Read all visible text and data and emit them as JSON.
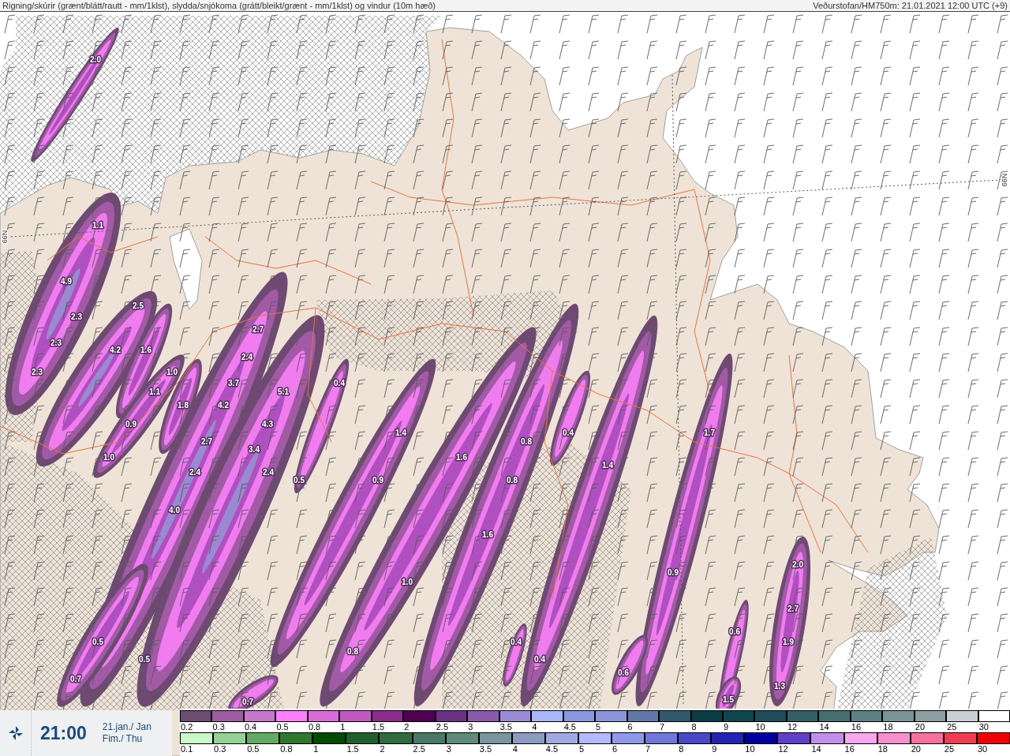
{
  "header": {
    "title": "Rigning/skúrir (grænt/blátt/rautt - mm/1klst), slydda/snjókoma (grátt/bleikt/grænt - mm/1klst) og vindur (10m hæð)",
    "source": "Veðurstofan/HM750m: 21.01.2021 12:00 UTC (+9)"
  },
  "map": {
    "latitude_labels": [
      "66N",
      "66N"
    ],
    "value_labels": [
      "2.0",
      "1.1",
      "4.9",
      "2.5",
      "2.3",
      "2.7",
      "2.3",
      "4.2",
      "1.6",
      "2.4",
      "2.3",
      "1.0",
      "3.7",
      "0.4",
      "1.1",
      "5.1",
      "1.8",
      "4.2",
      "0.9",
      "4.3",
      "1.4",
      "0.4",
      "1.7",
      "2.7",
      "0.8",
      "3.4",
      "1.0",
      "1.6",
      "1.4",
      "2.4",
      "2.4",
      "0.5",
      "0.9",
      "0.8",
      "4.0",
      "1.6",
      "2.0",
      "0.9",
      "1.0",
      "2.7",
      "0.6",
      "0.5",
      "0.4",
      "1.9",
      "0.8",
      "0.5",
      "0.4",
      "0.6",
      "0.7",
      "1.3",
      "0.7",
      "1.5"
    ]
  },
  "time_panel": {
    "time": "21:00",
    "date": "21.jan./ Jan",
    "weekday": "Fim./ Thu"
  },
  "legend": {
    "snow_scale": [
      {
        "label": "0.2",
        "color": "#6b4d70"
      },
      {
        "label": "0.3",
        "color": "#9e5ca2"
      },
      {
        "label": "0.4",
        "color": "#c878cc"
      },
      {
        "label": "0.5",
        "color": "#fc80fc"
      },
      {
        "label": "0.8",
        "color": "#d86cd8"
      },
      {
        "label": "1",
        "color": "#c05ac0"
      },
      {
        "label": "1.5",
        "color": "#8c2c8c"
      },
      {
        "label": "2",
        "color": "#500050"
      },
      {
        "label": "2.5",
        "color": "#6a3282"
      },
      {
        "label": "3",
        "color": "#8a5aaa"
      },
      {
        "label": "3.5",
        "color": "#9a8cd4"
      },
      {
        "label": "4",
        "color": "#aab6f8"
      },
      {
        "label": "4.5",
        "color": "#8c98dc"
      },
      {
        "label": "5",
        "color": "#8a96d8"
      },
      {
        "label": "6",
        "color": "#6478a8"
      },
      {
        "label": "7",
        "color": "#32586c"
      },
      {
        "label": "8",
        "color": "#0a3c46"
      },
      {
        "label": "9",
        "color": "#10464e"
      },
      {
        "label": "10",
        "color": "#1e4c58"
      },
      {
        "label": "12",
        "color": "#326064"
      },
      {
        "label": "14",
        "color": "#466e70"
      },
      {
        "label": "16",
        "color": "#5a8084"
      },
      {
        "label": "18",
        "color": "#7a9498"
      },
      {
        "label": "20",
        "color": "#8ca0a4"
      },
      {
        "label": "25",
        "color": "#c8d0d4"
      },
      {
        "label": "30",
        "color": "#ffffff"
      }
    ],
    "rain_scale": [
      {
        "label": "0.1",
        "color": "#c8f8c8"
      },
      {
        "label": "0.3",
        "color": "#96d296"
      },
      {
        "label": "0.5",
        "color": "#64aa64"
      },
      {
        "label": "0.8",
        "color": "#2d782d"
      },
      {
        "label": "1",
        "color": "#004b00"
      },
      {
        "label": "1.5",
        "color": "#1e5f2d"
      },
      {
        "label": "2",
        "color": "#2f6b3f"
      },
      {
        "label": "2.5",
        "color": "#4a7866"
      },
      {
        "label": "3",
        "color": "#5f8a7e"
      },
      {
        "label": "3.5",
        "color": "#7a94a0"
      },
      {
        "label": "4",
        "color": "#8c9cc0"
      },
      {
        "label": "4.5",
        "color": "#a0aae0"
      },
      {
        "label": "5",
        "color": "#b4b8ff"
      },
      {
        "label": "6",
        "color": "#9098e8"
      },
      {
        "label": "7",
        "color": "#7078dc"
      },
      {
        "label": "8",
        "color": "#4848c8"
      },
      {
        "label": "9",
        "color": "#2424b4"
      },
      {
        "label": "10",
        "color": "#0000a0"
      },
      {
        "label": "12",
        "color": "#6040c8"
      },
      {
        "label": "14",
        "color": "#c090e8"
      },
      {
        "label": "16",
        "color": "#f8a8f0"
      },
      {
        "label": "18",
        "color": "#f890d0"
      },
      {
        "label": "20",
        "color": "#f870a0"
      },
      {
        "label": "25",
        "color": "#f03c50"
      },
      {
        "label": "30",
        "color": "#f00000"
      }
    ]
  }
}
